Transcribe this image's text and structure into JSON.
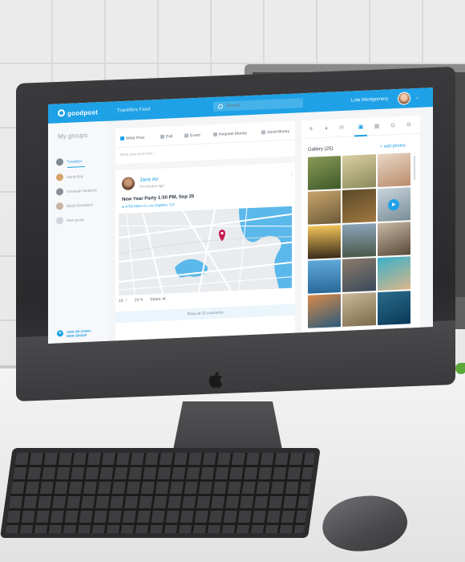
{
  "header": {
    "logo": "goodpost",
    "feed_title": "Travellers Feed",
    "search_placeholder": "Search",
    "user_name": "Lola Montgomery"
  },
  "sidebar": {
    "title": "My groups",
    "items": [
      {
        "label": "Travellers",
        "active": true
      },
      {
        "label": "Manly Bay"
      },
      {
        "label": "Graduate Students"
      },
      {
        "label": "Blood Donations"
      },
      {
        "label": "New group"
      }
    ],
    "join_line1": "JOIN OR START",
    "join_line2": "NEW GROUP"
  },
  "composer": {
    "tabs": [
      "Write Post",
      "Poll",
      "Event",
      "Request Money",
      "Send Money"
    ],
    "placeholder": "Write your post here..."
  },
  "post": {
    "author": "Jane Air",
    "time": "24 minutes ago",
    "title": "New Year Party 1:50 PM, Sep 25",
    "address": "4705 Main st, Los Angeles, CA",
    "likes": "15",
    "comments": "23",
    "share": "Share",
    "show_comments": "Show all 23 comments"
  },
  "gallery": {
    "title": "Gallery (25)",
    "add": "+ add photos"
  },
  "colors": {
    "accent": "#1ea1e6",
    "map_pin": "#c8174f",
    "water": "#5bb8ea"
  }
}
